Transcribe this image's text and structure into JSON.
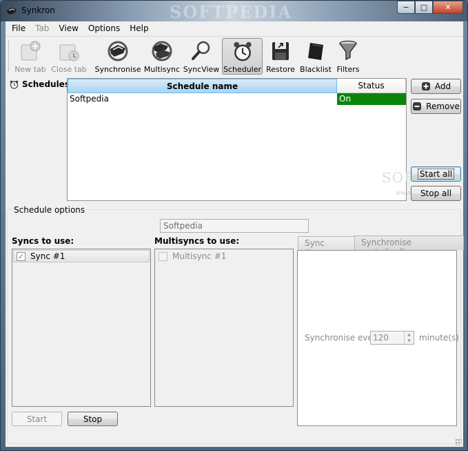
{
  "window": {
    "title": "Synkron",
    "watermark": "SOFTPEDIA",
    "buttons": {
      "minimize": "−",
      "maximize": "□",
      "close": "✕"
    }
  },
  "menu": [
    {
      "label": "File",
      "enabled": true
    },
    {
      "label": "Tab",
      "enabled": false
    },
    {
      "label": "View",
      "enabled": true
    },
    {
      "label": "Options",
      "enabled": true
    },
    {
      "label": "Help",
      "enabled": true
    }
  ],
  "toolbar": {
    "new_tab": "New tab",
    "close_tab": "Close tab",
    "synchronise": "Synchronise",
    "multisync": "Multisync",
    "syncview": "SyncView",
    "scheduler": "Scheduler",
    "restore": "Restore",
    "blacklist": "Blacklist",
    "filters": "Filters"
  },
  "schedules": {
    "label": "Schedules:",
    "columns": {
      "name": "Schedule name",
      "status": "Status"
    },
    "rows": [
      {
        "name": "Softpedia",
        "status": "On"
      }
    ],
    "status_on_color": "#098609",
    "add_button": "Add",
    "remove_button": "Remove",
    "start_all_button": "Start all",
    "stop_all_button": "Stop all"
  },
  "schedule_options": {
    "title": "Schedule options",
    "name_value": "Softpedia",
    "syncs_label": "Syncs to use:",
    "syncs": [
      {
        "label": "Sync #1",
        "checked": true
      }
    ],
    "multisyncs_label": "Multisyncs to use:",
    "multisyncs": [
      {
        "label": "Multisync #1",
        "checked": false
      }
    ],
    "tabs": {
      "sync_times": "Sync times",
      "periodically": "Synchronise periodically"
    },
    "period_label": "Synchronise every",
    "period_value": "120",
    "period_unit": "minute(s)",
    "start_button": "Start",
    "stop_button": "Stop"
  },
  "page_watermark": {
    "big": "SOFT",
    "small": "www.softpedia"
  }
}
